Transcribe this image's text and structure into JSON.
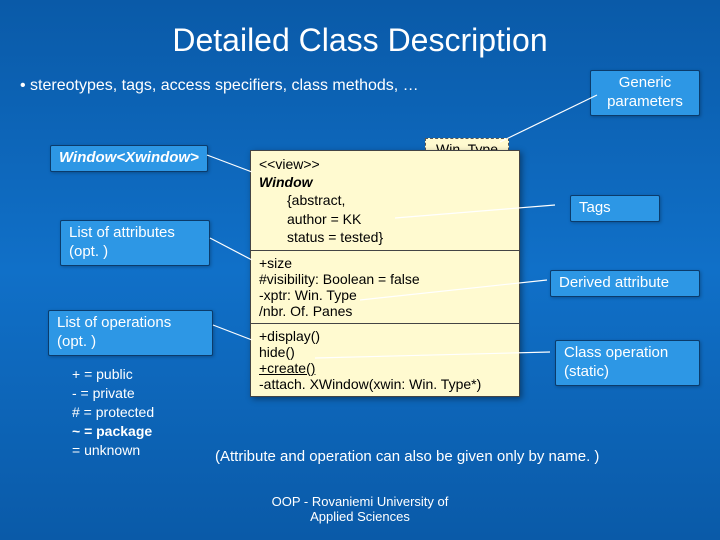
{
  "title": "Detailed Class Description",
  "subtitle": "• stereotypes, tags, access specifiers, class methods, …",
  "labels": {
    "generic_params": "Generic parameters",
    "winclass": "Window<Xwindow>",
    "list_attr_l1": "List of attributes",
    "list_attr_l2": "(opt. )",
    "list_ops_l1": "List of operations",
    "list_ops_l2": "(opt. )",
    "tags": "Tags",
    "derived": "Derived attribute",
    "class_op_l1": "Class operation",
    "class_op_l2": "(static)"
  },
  "wintype": "Win. Type",
  "uml": {
    "stereo": "<<view>>",
    "name": "Window",
    "tag1": "{abstract,",
    "tag2": "author = KK",
    "tag3": "status = tested}",
    "attr1": "+size",
    "attr2": "#visibility: Boolean = false",
    "attr3": "-xptr: Win. Type",
    "attr4": "/nbr. Of. Panes",
    "op1": "+display()",
    "op2": "hide()",
    "op3": "+create()",
    "op4": "-attach. XWindow(xwin: Win. Type*)"
  },
  "access": {
    "l1": "+ = public",
    "l2": "-  = private",
    "l3": "# = protected",
    "l4": "~ = package",
    "l5": "   = unknown"
  },
  "caption": "(Attribute and operation can also be given only by name. )",
  "footer_l1": "OOP - Rovaniemi University of",
  "footer_l2": "Applied Sciences"
}
